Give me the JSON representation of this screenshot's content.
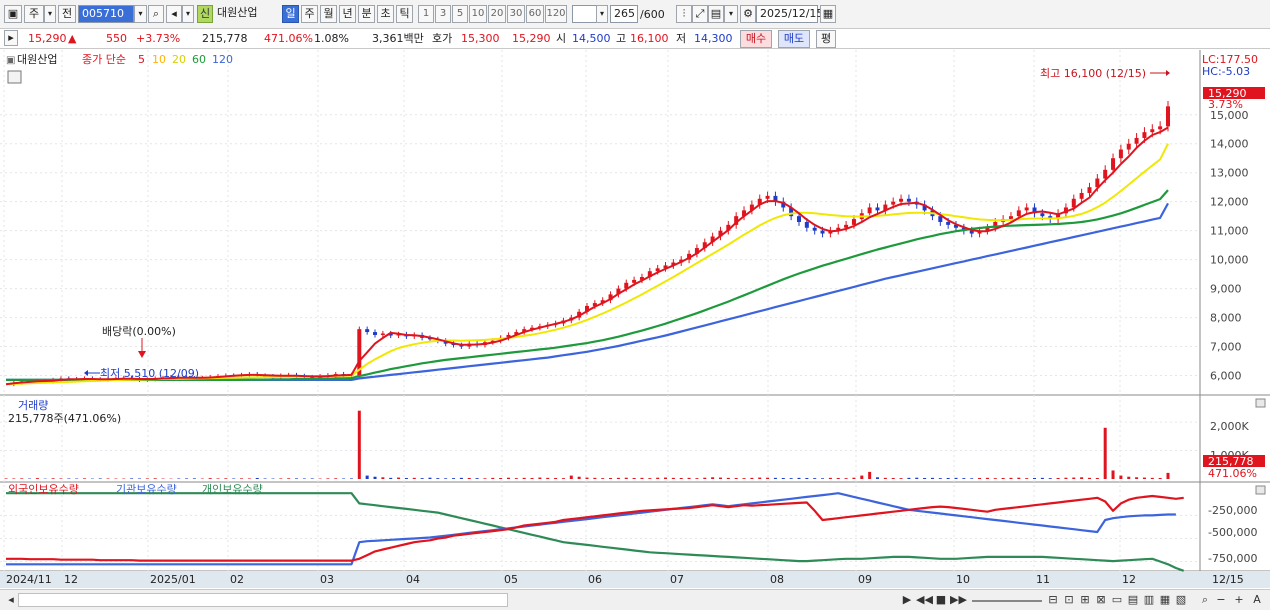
{
  "toolbar": {
    "market": "주",
    "prev": "전",
    "code": "005710",
    "badge": "신",
    "name": "대원산업",
    "periods": [
      "일",
      "주",
      "월",
      "년",
      "분",
      "초",
      "틱"
    ],
    "active_period": "일",
    "minutes": [
      "1",
      "3",
      "5",
      "10",
      "20",
      "30",
      "60",
      "120"
    ],
    "count": "265",
    "count_max": "/600",
    "date": "2025/12/15"
  },
  "quote": {
    "price": "15,290",
    "arrow": "▲",
    "change": "550",
    "change_pct": "+3.73%",
    "volume": "215,778",
    "volume_ratio": "471.06%",
    "turnover": "1.08%",
    "amount": "3,361백만",
    "hoga_label": "호가",
    "ask": "15,300",
    "bid": "15,290",
    "open_label": "시",
    "open": "14,500",
    "high_label": "고",
    "high": "16,100",
    "low_label": "저",
    "low": "14,300",
    "buy": "매수",
    "sell": "매도",
    "eval": "평"
  },
  "legend": {
    "name": "대원산업",
    "price_label": "종가 단순",
    "mas": [
      "5",
      "10",
      "20",
      "60",
      "120"
    ],
    "ma_colors": [
      "#e0141e",
      "#ffb400",
      "#f0e800",
      "#1e9a3c",
      "#3c64dc"
    ]
  },
  "price_panel": {
    "lc": "LC:177.50",
    "hc": "HC:-5.03",
    "last_label": "15,290",
    "last_pct": "3.73%",
    "high_note": "최고 16,100 (12/15)",
    "low_note": "최저 5,510 (12/09)",
    "dividend_note": "배당락(0.00%)"
  },
  "volume_panel": {
    "title": "거래량",
    "value": "215,778주(471.06%)",
    "axis": [
      "2,000K",
      "1,000K"
    ],
    "last_label": "215,778",
    "last_pct": "471.06%"
  },
  "holder_panel": {
    "labels": [
      "외국인보유수량",
      "기관보유수량",
      "개인보유수량"
    ],
    "colors": [
      "#e0141e",
      "#3c64dc",
      "#2e8b57"
    ],
    "axis": [
      "-250,000",
      "-500,000",
      "-750,000"
    ]
  },
  "time_axis": [
    "2024/11",
    "12",
    "2025/01",
    "02",
    "03",
    "04",
    "05",
    "06",
    "07",
    "08",
    "09",
    "10",
    "11",
    "12"
  ],
  "time_axis_right": "12/15",
  "chart_data": {
    "type": "line",
    "price_axis": [
      "15,000",
      "14,000",
      "13,000",
      "12,000",
      "11,000",
      "10,000",
      "9,000",
      "8,000",
      "7,000",
      "6,000"
    ],
    "close": [
      5700,
      5750,
      5800,
      5780,
      5820,
      5790,
      5850,
      5900,
      5880,
      5850,
      5900,
      5870,
      5860,
      5880,
      5900,
      5920,
      5880,
      5850,
      5870,
      5900,
      5920,
      5940,
      5930,
      5910,
      5890,
      5920,
      5950,
      5980,
      6000,
      5990,
      6020,
      6050,
      6000,
      5980,
      5960,
      6000,
      6020,
      5990,
      5950,
      5920,
      5980,
      6010,
      6050,
      6020,
      6000,
      7600,
      7500,
      7400,
      7450,
      7380,
      7420,
      7350,
      7400,
      7300,
      7250,
      7200,
      7100,
      7050,
      7000,
      7100,
      7050,
      7150,
      7200,
      7300,
      7400,
      7500,
      7600,
      7650,
      7700,
      7750,
      7800,
      7900,
      8000,
      8200,
      8400,
      8500,
      8600,
      8800,
      9000,
      9200,
      9300,
      9400,
      9600,
      9700,
      9800,
      9900,
      10000,
      10200,
      10400,
      10600,
      10800,
      11000,
      11200,
      11500,
      11700,
      11900,
      12100,
      12200,
      12000,
      11800,
      11500,
      11300,
      11100,
      11000,
      10900,
      11000,
      11100,
      11200,
      11400,
      11600,
      11800,
      11700,
      11900,
      12000,
      12100,
      12000,
      11900,
      11700,
      11500,
      11300,
      11200,
      11100,
      11000,
      10900,
      11000,
      11100,
      11300,
      11400,
      11500,
      11700,
      11800,
      11600,
      11500,
      11400,
      11600,
      11800,
      12100,
      12300,
      12500,
      12800,
      13100,
      13500,
      13800,
      14000,
      14200,
      14400,
      14500,
      14600,
      15290
    ],
    "ma5": [
      5700,
      5730,
      5760,
      5780,
      5800,
      5810,
      5820,
      5850,
      5870,
      5870,
      5880,
      5880,
      5870,
      5870,
      5880,
      5890,
      5890,
      5880,
      5880,
      5880,
      5900,
      5910,
      5920,
      5920,
      5920,
      5920,
      5930,
      5950,
      5970,
      5990,
      6010,
      6020,
      6020,
      6010,
      6000,
      5990,
      5990,
      5990,
      5980,
      5970,
      5970,
      5980,
      6000,
      6010,
      6020,
      6500,
      6800,
      7100,
      7300,
      7470,
      7440,
      7400,
      7390,
      7360,
      7310,
      7250,
      7180,
      7110,
      7060,
      7060,
      7070,
      7090,
      7140,
      7200,
      7300,
      7400,
      7500,
      7580,
      7650,
      7720,
      7780,
      7850,
      7940,
      8060,
      8220,
      8380,
      8500,
      8640,
      8820,
      8980,
      9140,
      9280,
      9420,
      9560,
      9680,
      9800,
      9920,
      10060,
      10220,
      10420,
      10620,
      10820,
      11020,
      11280,
      11500,
      11700,
      11900,
      12020,
      12020,
      11960,
      11800,
      11600,
      11380,
      11200,
      11060,
      10980,
      11000,
      11060,
      11160,
      11300,
      11460,
      11580,
      11700,
      11820,
      11920,
      11940,
      11960,
      11880,
      11720,
      11540,
      11360,
      11220,
      11120,
      11020,
      10980,
      10980,
      11060,
      11160,
      11280,
      11440,
      11580,
      11640,
      11660,
      11620,
      11560,
      11660,
      11760,
      11960,
      12140,
      12460,
      12740,
      13000,
      13300,
      13560,
      13860,
      14100,
      14300,
      14400,
      14560
    ],
    "ma20": [
      5700,
      5710,
      5720,
      5730,
      5740,
      5750,
      5760,
      5770,
      5780,
      5790,
      5800,
      5810,
      5820,
      5830,
      5840,
      5850,
      5855,
      5860,
      5865,
      5870,
      5880,
      5885,
      5890,
      5895,
      5900,
      5905,
      5910,
      5915,
      5920,
      5925,
      5930,
      5935,
      5940,
      5945,
      5950,
      5955,
      5960,
      5965,
      5970,
      5970,
      5975,
      5980,
      5985,
      5990,
      5995,
      6200,
      6400,
      6560,
      6700,
      6840,
      6950,
      7020,
      7080,
      7130,
      7170,
      7200,
      7210,
      7210,
      7200,
      7210,
      7220,
      7230,
      7250,
      7270,
      7300,
      7330,
      7370,
      7410,
      7460,
      7520,
      7580,
      7650,
      7730,
      7820,
      7920,
      8030,
      8140,
      8260,
      8390,
      8520,
      8660,
      8800,
      8950,
      9100,
      9250,
      9400,
      9560,
      9720,
      9880,
      10040,
      10200,
      10360,
      10520,
      10690,
      10860,
      11020,
      11180,
      11320,
      11440,
      11530,
      11590,
      11620,
      11620,
      11600,
      11570,
      11540,
      11520,
      11500,
      11490,
      11490,
      11500,
      11510,
      11530,
      11560,
      11590,
      11610,
      11620,
      11620,
      11600,
      11570,
      11540,
      11500,
      11460,
      11420,
      11390,
      11370,
      11360,
      11360,
      11370,
      11390,
      11410,
      11420,
      11420,
      11420,
      11430,
      11460,
      11510,
      11580,
      11680,
      11810,
      11970,
      12160,
      12370,
      12590,
      12810,
      13030,
      13250,
      13460,
      14000
    ],
    "ma60": [
      5850,
      5850,
      5850,
      5850,
      5850,
      5850,
      5850,
      5850,
      5850,
      5850,
      5850,
      5850,
      5850,
      5850,
      5850,
      5850,
      5850,
      5850,
      5850,
      5850,
      5850,
      5850,
      5850,
      5850,
      5850,
      5850,
      5850,
      5850,
      5850,
      5850,
      5850,
      5860,
      5860,
      5860,
      5870,
      5870,
      5870,
      5880,
      5880,
      5880,
      5890,
      5890,
      5900,
      5900,
      5910,
      5980,
      6040,
      6100,
      6160,
      6220,
      6270,
      6320,
      6370,
      6420,
      6460,
      6500,
      6540,
      6570,
      6600,
      6630,
      6660,
      6690,
      6720,
      6750,
      6780,
      6810,
      6840,
      6870,
      6900,
      6930,
      6960,
      7000,
      7040,
      7080,
      7120,
      7170,
      7220,
      7280,
      7340,
      7410,
      7480,
      7550,
      7630,
      7710,
      7790,
      7880,
      7970,
      8060,
      8150,
      8250,
      8350,
      8450,
      8550,
      8660,
      8770,
      8880,
      8990,
      9100,
      9210,
      9320,
      9420,
      9520,
      9610,
      9700,
      9790,
      9870,
      9950,
      10030,
      10110,
      10190,
      10270,
      10350,
      10420,
      10490,
      10560,
      10630,
      10700,
      10760,
      10820,
      10880,
      10930,
      10980,
      11020,
      11060,
      11090,
      11120,
      11140,
      11160,
      11170,
      11180,
      11190,
      11200,
      11210,
      11220,
      11230,
      11250,
      11270,
      11300,
      11340,
      11390,
      11450,
      11520,
      11600,
      11690,
      11790,
      11890,
      11990,
      12090,
      12400
    ],
    "ma120": [
      5850,
      5850,
      5850,
      5850,
      5850,
      5850,
      5850,
      5850,
      5850,
      5850,
      5850,
      5850,
      5850,
      5850,
      5850,
      5850,
      5850,
      5850,
      5850,
      5850,
      5850,
      5850,
      5850,
      5850,
      5850,
      5850,
      5850,
      5850,
      5850,
      5850,
      5850,
      5850,
      5850,
      5850,
      5850,
      5850,
      5850,
      5850,
      5850,
      5850,
      5850,
      5850,
      5850,
      5850,
      5850,
      5900,
      5930,
      5960,
      5990,
      6020,
      6050,
      6080,
      6110,
      6140,
      6170,
      6200,
      6230,
      6260,
      6290,
      6320,
      6350,
      6380,
      6410,
      6440,
      6470,
      6500,
      6530,
      6560,
      6590,
      6620,
      6660,
      6700,
      6740,
      6780,
      6820,
      6870,
      6920,
      6970,
      7020,
      7080,
      7140,
      7200,
      7260,
      7320,
      7380,
      7450,
      7520,
      7590,
      7660,
      7730,
      7800,
      7870,
      7940,
      8010,
      8080,
      8150,
      8220,
      8290,
      8360,
      8430,
      8500,
      8570,
      8640,
      8710,
      8780,
      8850,
      8920,
      8990,
      9060,
      9130,
      9200,
      9270,
      9340,
      9400,
      9460,
      9520,
      9580,
      9640,
      9700,
      9760,
      9820,
      9880,
      9940,
      10000,
      10060,
      10120,
      10180,
      10240,
      10300,
      10360,
      10420,
      10480,
      10540,
      10600,
      10660,
      10720,
      10780,
      10840,
      10900,
      10960,
      11020,
      11080,
      11140,
      11200,
      11260,
      11320,
      11380,
      11440,
      11940
    ],
    "volume": [
      20,
      18,
      22,
      15,
      30,
      12,
      25,
      20,
      18,
      16,
      22,
      14,
      20,
      18,
      16,
      15,
      22,
      18,
      20,
      25,
      15,
      12,
      18,
      20,
      22,
      15,
      30,
      20,
      25,
      18,
      22,
      20,
      35,
      18,
      15,
      20,
      25,
      22,
      18,
      20,
      15,
      22,
      25,
      18,
      20,
      2400,
      120,
      80,
      60,
      40,
      50,
      35,
      40,
      30,
      45,
      30,
      25,
      30,
      40,
      35,
      30,
      25,
      40,
      35,
      45,
      30,
      40,
      35,
      50,
      40,
      35,
      30,
      120,
      80,
      50,
      40,
      30,
      35,
      40,
      45,
      35,
      40,
      30,
      45,
      50,
      40,
      35,
      40,
      30,
      45,
      60,
      50,
      40,
      35,
      30,
      40,
      50,
      45,
      40,
      35,
      30,
      40,
      35,
      30,
      25,
      40,
      35,
      30,
      45,
      120,
      250,
      60,
      40,
      35,
      30,
      40,
      45,
      35,
      40,
      30,
      35,
      40,
      30,
      25,
      35,
      40,
      30,
      35,
      40,
      45,
      30,
      35,
      40,
      30,
      35,
      45,
      50,
      60,
      40,
      35,
      1800,
      300,
      120,
      80,
      60,
      50,
      40,
      35,
      215
    ],
    "foreign": [
      -720,
      -720,
      -720,
      -725,
      -725,
      -725,
      -725,
      -730,
      -730,
      -730,
      -730,
      -730,
      -735,
      -735,
      -735,
      -735,
      -735,
      -740,
      -740,
      -740,
      -740,
      -740,
      -740,
      -740,
      -740,
      -740,
      -740,
      -740,
      -740,
      -740,
      -740,
      -740,
      -740,
      -740,
      -740,
      -740,
      -740,
      -740,
      -740,
      -740,
      -740,
      -740,
      -740,
      -740,
      -740,
      -720,
      -680,
      -640,
      -620,
      -600,
      -580,
      -560,
      -540,
      -530,
      -520,
      -500,
      -490,
      -470,
      -460,
      -450,
      -440,
      -430,
      -420,
      -410,
      -400,
      -380,
      -360,
      -350,
      -340,
      -330,
      -320,
      -300,
      -290,
      -280,
      -270,
      -260,
      -250,
      -240,
      -230,
      -220,
      -210,
      -200,
      -195,
      -190,
      -185,
      -180,
      -175,
      -170,
      -160,
      -150,
      -140,
      -150,
      -160,
      -150,
      -140,
      -145,
      -140,
      -135,
      -130,
      -125,
      -120,
      -115,
      -110,
      -200,
      -300,
      -290,
      -280,
      -270,
      -260,
      -250,
      -240,
      -230,
      -220,
      -210,
      -200,
      -190,
      -180,
      -170,
      -160,
      -155,
      -160,
      -170,
      -180,
      -190,
      -200,
      -210,
      -190,
      -180,
      -170,
      -160,
      -150,
      -140,
      -130,
      -120,
      -110,
      -100,
      -90,
      -80,
      -70,
      -60,
      -100,
      -200,
      -120,
      -80,
      -60,
      -50,
      -40,
      -50,
      -60,
      -70,
      -60
    ],
    "institution": [
      -780,
      -780,
      -780,
      -780,
      -780,
      -780,
      -780,
      -780,
      -780,
      -780,
      -780,
      -780,
      -780,
      -780,
      -780,
      -780,
      -780,
      -780,
      -780,
      -780,
      -780,
      -780,
      -780,
      -780,
      -780,
      -780,
      -780,
      -780,
      -780,
      -780,
      -780,
      -780,
      -780,
      -780,
      -780,
      -780,
      -780,
      -780,
      -780,
      -780,
      -780,
      -780,
      -780,
      -780,
      -780,
      -540,
      -530,
      -525,
      -520,
      -515,
      -510,
      -505,
      -500,
      -495,
      -490,
      -480,
      -470,
      -460,
      -450,
      -440,
      -430,
      -420,
      -410,
      -400,
      -390,
      -380,
      -370,
      -360,
      -350,
      -340,
      -330,
      -320,
      -310,
      -300,
      -290,
      -280,
      -270,
      -260,
      -250,
      -240,
      -230,
      -220,
      -210,
      -200,
      -190,
      -180,
      -170,
      -160,
      -150,
      -140,
      -130,
      -140,
      -150,
      -140,
      -130,
      -120,
      -110,
      -100,
      -90,
      -80,
      -70,
      -60,
      -50,
      -40,
      -30,
      -20,
      -10,
      -30,
      -50,
      -70,
      -90,
      -110,
      -130,
      -150,
      -170,
      -190,
      -200,
      -210,
      -220,
      -230,
      -240,
      -250,
      -260,
      -270,
      -280,
      -290,
      -300,
      -310,
      -320,
      -330,
      -340,
      -350,
      -360,
      -370,
      -380,
      -390,
      -400,
      -410,
      -420,
      -430,
      -300,
      -280,
      -270,
      -260,
      -255,
      -250,
      -250,
      -245,
      -240,
      -240
    ],
    "individual": [
      -10,
      -10,
      -10,
      -10,
      -10,
      -10,
      -10,
      -10,
      -10,
      -10,
      -10,
      -10,
      -10,
      -10,
      -10,
      -10,
      -10,
      -10,
      -10,
      -10,
      -10,
      -10,
      -10,
      -10,
      -10,
      -10,
      -10,
      -10,
      -10,
      -10,
      -10,
      -10,
      -10,
      -10,
      -10,
      -10,
      -10,
      -10,
      -10,
      -10,
      -10,
      -10,
      -10,
      -10,
      -10,
      -120,
      -130,
      -140,
      -150,
      -160,
      -170,
      -180,
      -190,
      -200,
      -210,
      -220,
      -240,
      -260,
      -280,
      -300,
      -320,
      -340,
      -360,
      -380,
      -400,
      -420,
      -440,
      -460,
      -480,
      -500,
      -520,
      -540,
      -550,
      -560,
      -570,
      -580,
      -590,
      -600,
      -610,
      -620,
      -630,
      -640,
      -650,
      -655,
      -660,
      -665,
      -670,
      -675,
      -680,
      -685,
      -690,
      -695,
      -700,
      -705,
      -710,
      -715,
      -720,
      -725,
      -730,
      -735,
      -740,
      -745,
      -745,
      -740,
      -735,
      -730,
      -725,
      -720,
      -720,
      -720,
      -715,
      -710,
      -705,
      -700,
      -700,
      -700,
      -705,
      -710,
      -715,
      -720,
      -720,
      -720,
      -715,
      -710,
      -705,
      -700,
      -700,
      -700,
      -700,
      -700,
      -700,
      -700,
      -700,
      -705,
      -710,
      -715,
      -720,
      -725,
      -730,
      -735,
      -740,
      -745,
      -740,
      -735,
      -730,
      -725,
      -720,
      -750,
      -780,
      -820,
      -850
    ]
  }
}
